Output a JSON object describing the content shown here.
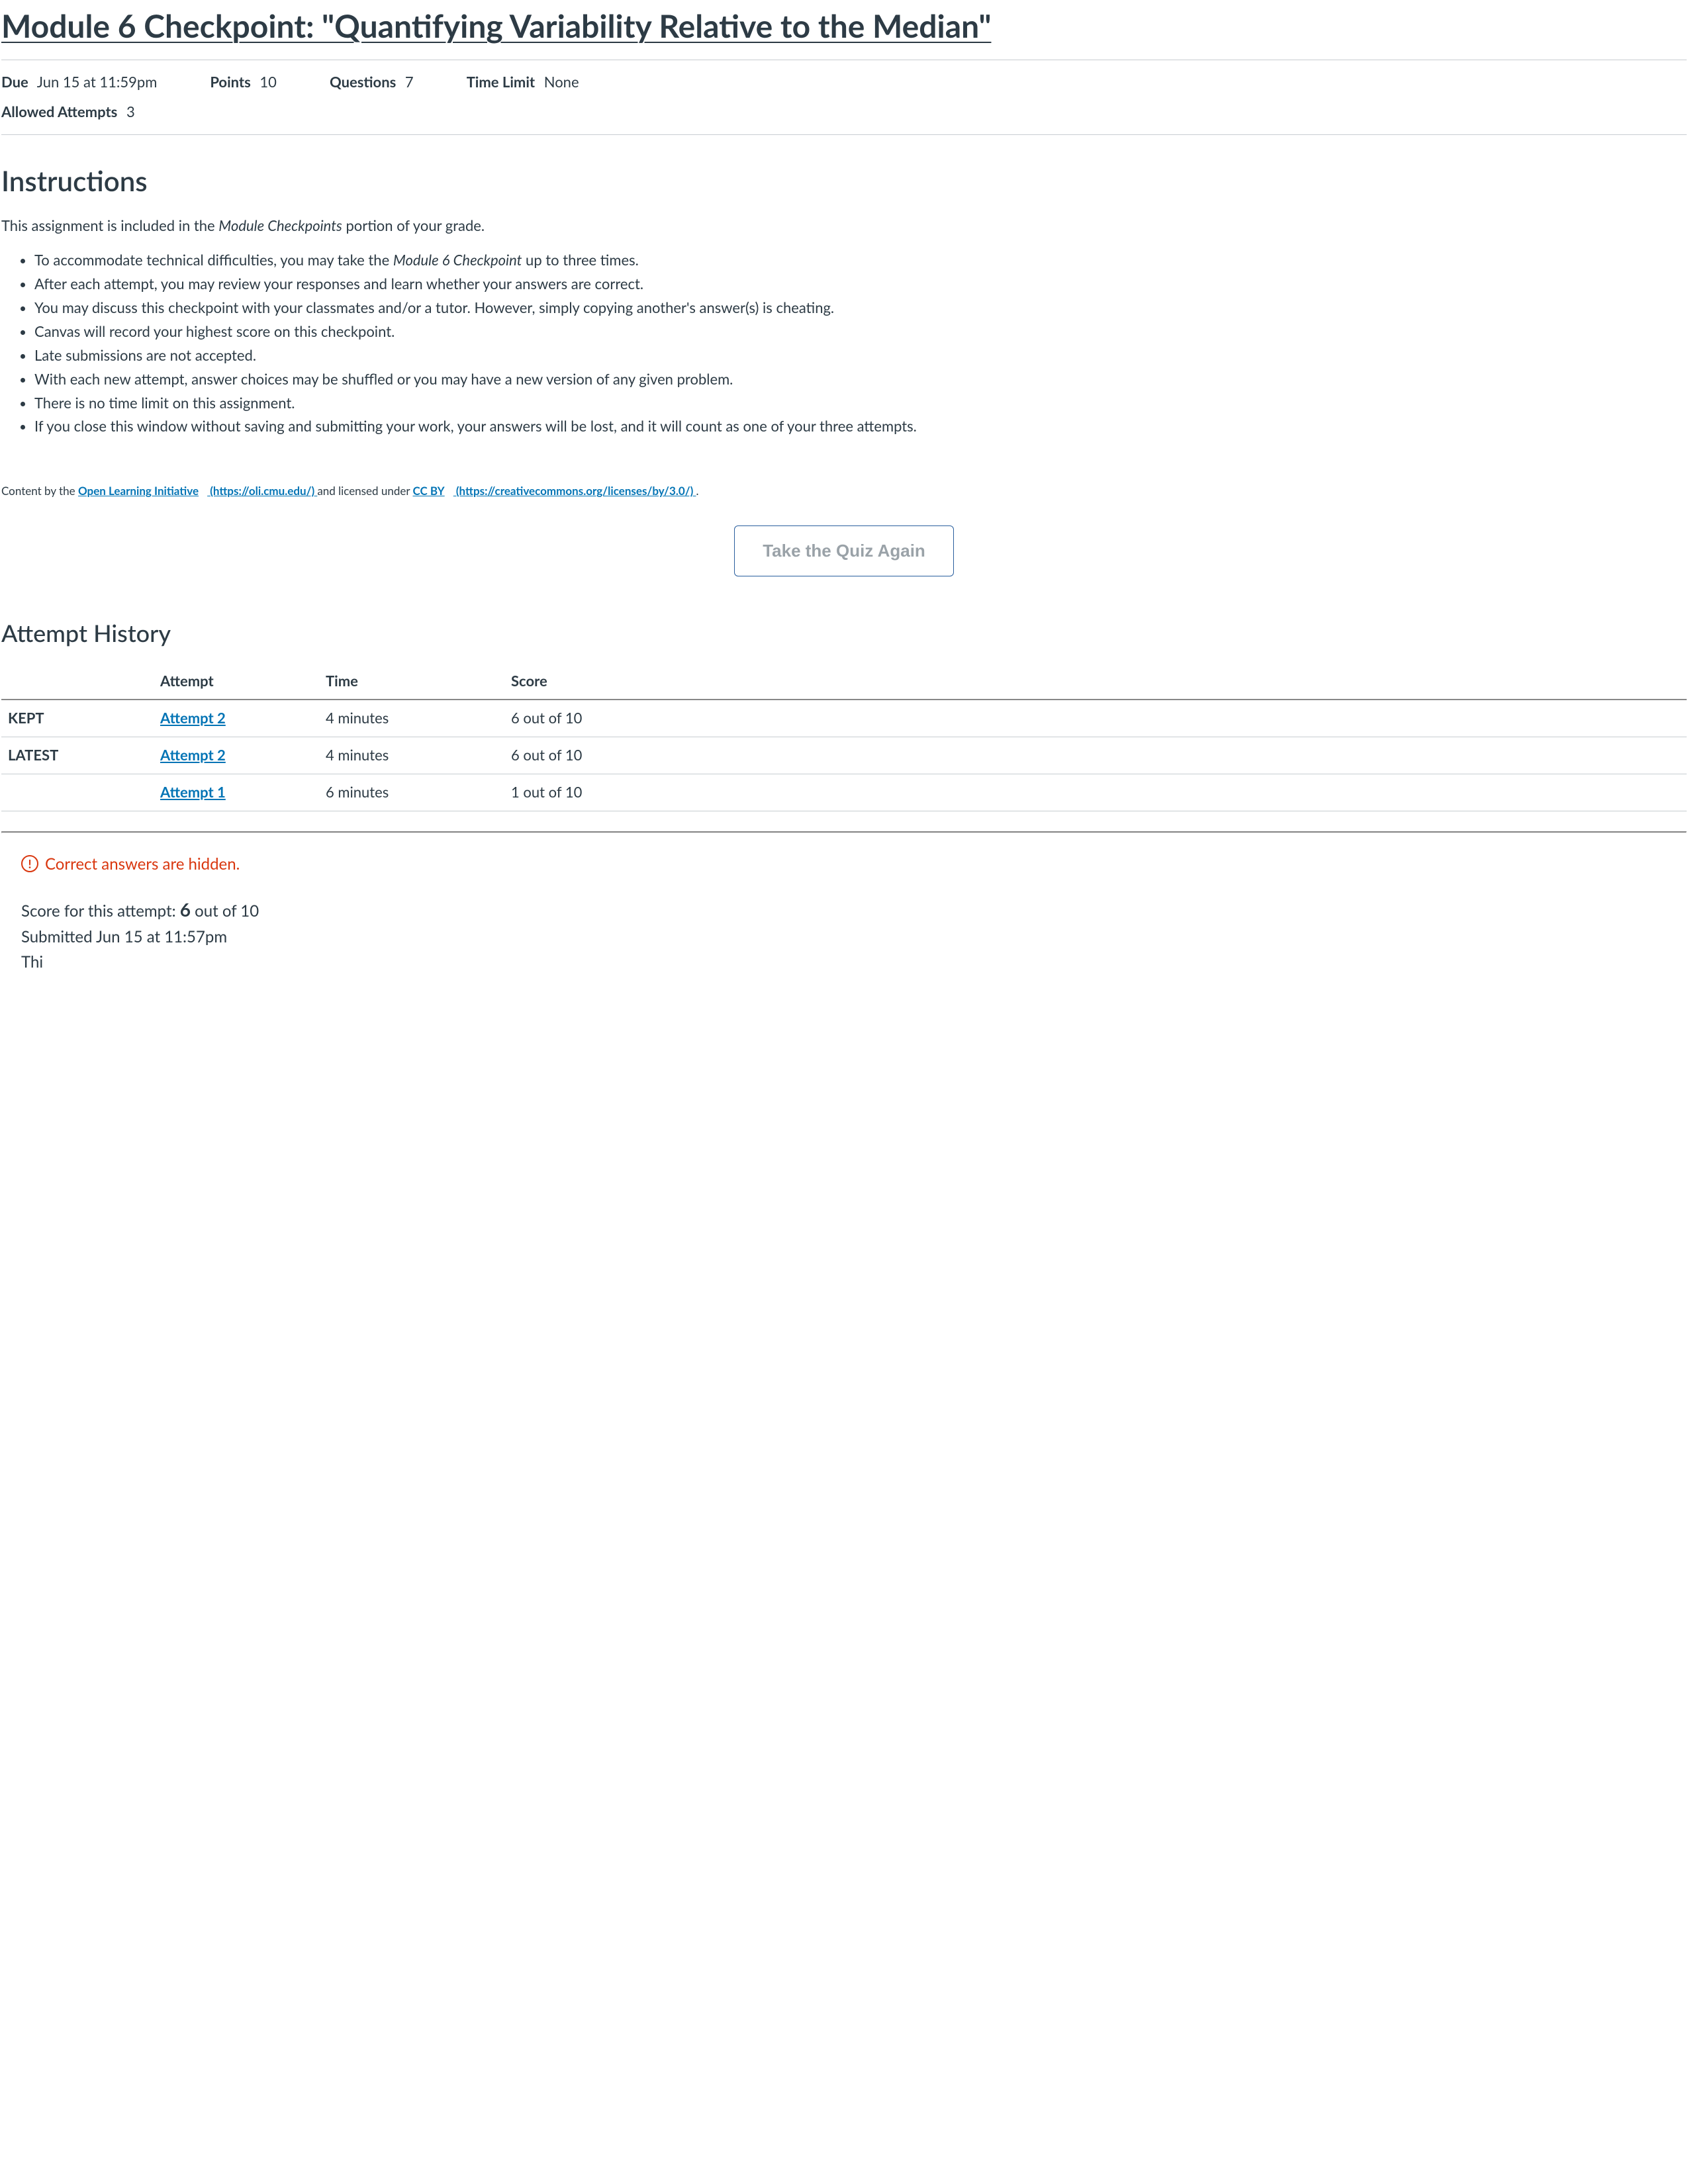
{
  "title": "Module 6 Checkpoint: \"Quantifying Variability Relative to the Median\"",
  "meta": {
    "due_label": "Due",
    "due_value": "Jun 15 at 11:59pm",
    "points_label": "Points",
    "points_value": "10",
    "questions_label": "Questions",
    "questions_value": "7",
    "time_limit_label": "Time Limit",
    "time_limit_value": "None",
    "allowed_attempts_label": "Allowed Attempts",
    "allowed_attempts_value": "3"
  },
  "instructions_heading": "Instructions",
  "instructions_intro_pre": "This assignment is included in the ",
  "instructions_intro_em": "Module Checkpoints",
  "instructions_intro_post": " portion of your grade.",
  "bullets": {
    "b0_pre": "To accommodate technical difficulties, you may take the ",
    "b0_em": "Module 6 Checkpoint",
    "b0_post": " up to three times.",
    "b1": "After each attempt, you may review your responses and learn whether your answers are correct.",
    "b2": "You may discuss this checkpoint with your classmates and/or a tutor. However, simply copying another's answer(s) is cheating.",
    "b3": "Canvas will record your highest score on this checkpoint.",
    "b4": "Late submissions are not accepted.",
    "b5": "With each new attempt, answer choices may be shuffled or you may have a new version of any given problem.",
    "b6": "There is no time limit on this assignment.",
    "b7": "If you close this window without saving and submitting your work, your answers will be lost, and it will count as one of your three attempts."
  },
  "attribution": {
    "prefix": "Content by the ",
    "oli_text": "Open Learning Initiative",
    "oli_url_text": " (https://oli.cmu.edu/) ",
    "mid": "and licensed under ",
    "cc_text": "CC BY",
    "cc_url_text": " (https://creativecommons.org/licenses/by/3.0/) ",
    "suffix": "."
  },
  "take_again_label": "Take the Quiz Again",
  "history_heading": "Attempt History",
  "history_cols": {
    "tag": "",
    "attempt": "Attempt",
    "time": "Time",
    "score": "Score"
  },
  "history_rows": [
    {
      "tag": "KEPT",
      "attempt": "Attempt 2",
      "time": "4 minutes",
      "score": "6 out of 10"
    },
    {
      "tag": "LATEST",
      "attempt": "Attempt 2",
      "time": "4 minutes",
      "score": "6 out of 10"
    },
    {
      "tag": "",
      "attempt": "Attempt 1",
      "time": "6 minutes",
      "score": "1 out of 10"
    }
  ],
  "hidden_banner": "Correct answers are hidden.",
  "score_line_pre": "Score for this attempt: ",
  "score_line_big": "6",
  "score_line_post": " out of 10",
  "submitted_line": "Submitted Jun 15 at 11:57pm",
  "truncated_line": "Thi"
}
